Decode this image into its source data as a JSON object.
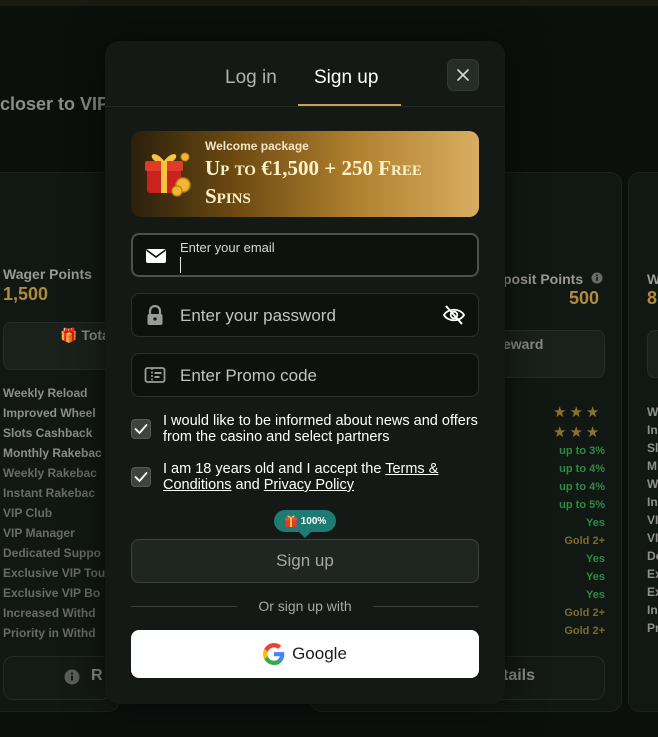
{
  "background": {
    "heading": "closer to VIP",
    "left_card": {
      "points_label": "Wager Points",
      "points_value": "1,500",
      "button_label": "🎁 Tota",
      "items": [
        "Weekly Reload",
        "Improved Wheel",
        "Slots Cashback",
        "Monthly Rakebac",
        "Weekly Rakebac",
        "Instant Rakebac",
        "VIP Club",
        "VIP Manager",
        "Dedicated Suppo",
        "Exclusive VIP Tou",
        "Exclusive VIP Bo",
        "Increased Withd",
        "Priority in Withd"
      ],
      "bottom_button": "R"
    },
    "mid_card": {
      "points_label": "posit Points",
      "points_value": "500",
      "button_label": "eward",
      "values": [
        "up to 3%",
        "up to 4%",
        "up to 4%",
        "up to 5%",
        "Yes",
        "Gold 2+",
        "Yes",
        "Yes",
        "Yes",
        "Gold 2+",
        "Gold 2+"
      ],
      "bottom_button": "tails"
    },
    "right_card": {
      "points_label": "W",
      "points_value": "8",
      "items": [
        "W",
        "In",
        "Sl",
        "M",
        "W",
        "In",
        "VI",
        "VI",
        "De",
        "Ex",
        "Ex",
        "In",
        "Pr"
      ]
    }
  },
  "modal": {
    "tabs": [
      {
        "label": "Log in",
        "active": false
      },
      {
        "label": "Sign up",
        "active": true
      }
    ],
    "promo": {
      "kicker": "Welcome package",
      "title": "Up to €1,500 + 250 Free Spins"
    },
    "email": {
      "label": "Enter your email",
      "value": ""
    },
    "password": {
      "placeholder": "Enter your password"
    },
    "promo_code": {
      "placeholder": "Enter Promo code"
    },
    "consent_news": {
      "checked": true,
      "text": "I would like to be informed about news and offers from the casino and select partners"
    },
    "consent_age": {
      "checked": true,
      "text_before": "I am 18 years old and I accept the ",
      "terms_link": "Terms & Conditions",
      "text_mid": " and ",
      "privacy_link": "Privacy Policy"
    },
    "bonus_badge": "100%",
    "signup_button": "Sign up",
    "divider_text": "Or sign up with",
    "google_button": "Google"
  },
  "colors": {
    "accent_gold": "#c9a152",
    "background": "#0c100d",
    "modal_bg": "#141915",
    "badge_teal": "#1e7a72",
    "success_green": "#2f8a43"
  },
  "icons": [
    "close-icon",
    "gift-box-icon",
    "mail-icon",
    "lock-icon",
    "eye-off-icon",
    "promo-ticket-icon",
    "checkmark-icon",
    "gift-icon",
    "google-logo-icon",
    "info-icon",
    "star-icon"
  ]
}
